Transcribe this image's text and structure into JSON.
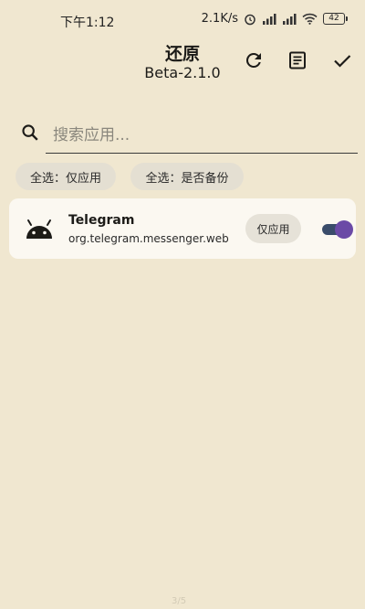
{
  "status_bar": {
    "time": "下午1:12",
    "speed": "2.1K/s",
    "battery": "42"
  },
  "app_bar": {
    "title": "还原",
    "subtitle": "Beta-2.1.0",
    "actions": [
      {
        "name": "refresh-icon"
      },
      {
        "name": "document-icon"
      },
      {
        "name": "check-icon"
      }
    ]
  },
  "search": {
    "placeholder": "搜索应用..."
  },
  "chips": [
    {
      "label": "全选：仅应用"
    },
    {
      "label": "全选：是否备份"
    }
  ],
  "apps": [
    {
      "name": "Telegram",
      "package": "org.telegram.messenger.web",
      "scope_label": "仅应用",
      "enabled": true,
      "icon": "android-icon"
    }
  ],
  "page_indicator": "3/5",
  "colors": {
    "background": "#f0e7d0",
    "card": "#fbf8f1",
    "chip": "#e4dfd2",
    "toggle_track": "#3a4c6a",
    "toggle_thumb": "#6b4aa6"
  }
}
